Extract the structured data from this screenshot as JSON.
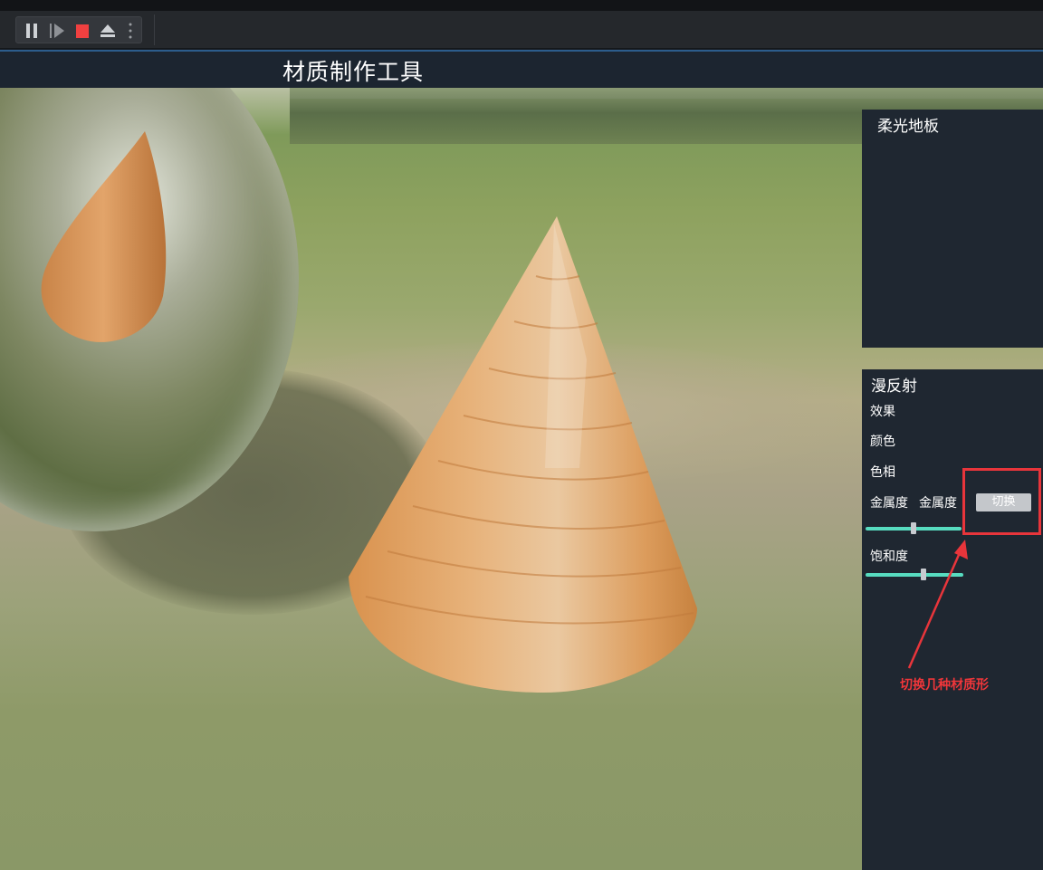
{
  "window": {
    "title": "材质制作工具"
  },
  "toolbar": {
    "buttons": [
      {
        "name": "pause-button",
        "icon": "pause-icon"
      },
      {
        "name": "step-button",
        "icon": "step-icon"
      },
      {
        "name": "stop-button",
        "icon": "stop-icon"
      },
      {
        "name": "eject-button",
        "icon": "eject-icon"
      },
      {
        "name": "more-options-button",
        "icon": "vertical-dots-icon"
      }
    ],
    "stop_color": "#f04040"
  },
  "panel_top": {
    "title": "柔光地板"
  },
  "panel": {
    "title": "漫反射",
    "effect_label": "效果",
    "color_label": "颜色",
    "hue_label": "色相",
    "metallic_label": "金属度",
    "metallic_value_label": "金属度",
    "switch_button": "切换",
    "metallic_slider_fraction": 0.5,
    "saturation_label": "饱和度",
    "saturation_slider_fraction": 0.59,
    "slider_color": "#57dcc0"
  },
  "annotation": {
    "text": "切换几种材质形",
    "color": "#e8353b"
  }
}
